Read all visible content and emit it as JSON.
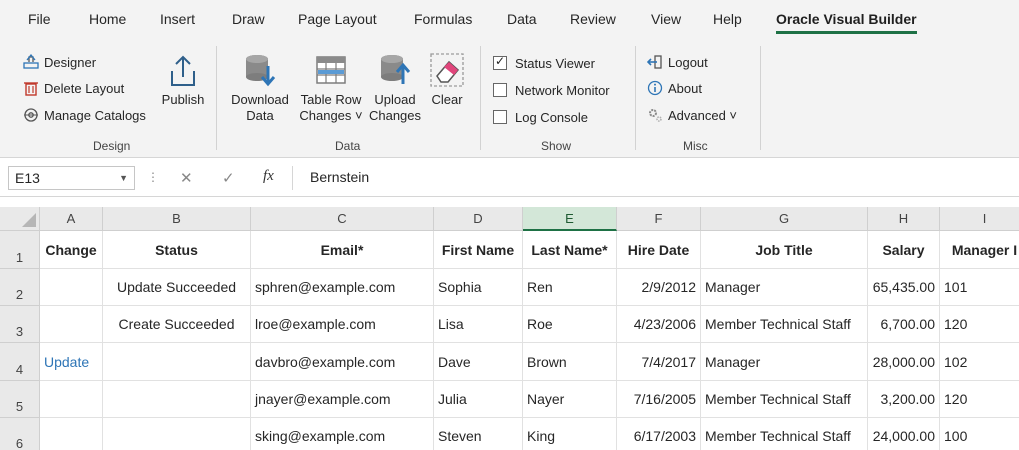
{
  "tabs": [
    "File",
    "Home",
    "Insert",
    "Draw",
    "Page Layout",
    "Formulas",
    "Data",
    "Review",
    "View",
    "Help",
    "Oracle Visual Builder"
  ],
  "active_tab": "Oracle Visual Builder",
  "accent_color": "#1e7145",
  "ribbon": {
    "design": {
      "label": "Design",
      "designer": "Designer",
      "delete_layout": "Delete Layout",
      "manage_catalogs": "Manage Catalogs",
      "publish": "Publish"
    },
    "data": {
      "label": "Data",
      "download_1": "Download",
      "download_2": "Data",
      "table_row_1": "Table Row",
      "table_row_2": "Changes ˅",
      "upload_1": "Upload",
      "upload_2": "Changes",
      "clear": "Clear"
    },
    "show": {
      "label": "Show",
      "status_viewer": "Status Viewer",
      "status_viewer_checked": true,
      "network_monitor": "Network Monitor",
      "log_console": "Log Console"
    },
    "misc": {
      "label": "Misc",
      "logout": "Logout",
      "about": "About",
      "advanced": "Advanced ˅"
    }
  },
  "formula_bar": {
    "name_box": "E13",
    "fx": "fx",
    "value": "Bernstein"
  },
  "grid": {
    "columns": [
      "A",
      "B",
      "C",
      "D",
      "E",
      "F",
      "G",
      "H",
      "I"
    ],
    "selected_column": "E",
    "rows": [
      "1",
      "2",
      "3",
      "4",
      "5",
      "6"
    ],
    "headers": [
      "Change",
      "Status",
      "Email*",
      "First Name",
      "Last Name*",
      "Hire Date",
      "Job Title",
      "Salary",
      "Manager I"
    ],
    "data": [
      [
        "",
        "Update Succeeded",
        "sphren@example.com",
        "Sophia",
        "Ren",
        "2/9/2012",
        "Manager",
        "65,435.00",
        "101"
      ],
      [
        "",
        "Create Succeeded",
        "lroe@example.com",
        "Lisa",
        "Roe",
        "4/23/2006",
        "Member Technical Staff",
        "6,700.00",
        "120"
      ],
      [
        "Update",
        "",
        "davbro@example.com",
        "Dave",
        "Brown",
        "7/4/2017",
        "Manager",
        "28,000.00",
        "102"
      ],
      [
        "",
        "",
        "jnayer@example.com",
        "Julia",
        "Nayer",
        "7/16/2005",
        "Member Technical Staff",
        "3,200.00",
        "120"
      ],
      [
        "",
        "",
        "sking@example.com",
        "Steven",
        "King",
        "6/17/2003",
        "Member Technical Staff",
        "24,000.00",
        "100"
      ]
    ]
  }
}
